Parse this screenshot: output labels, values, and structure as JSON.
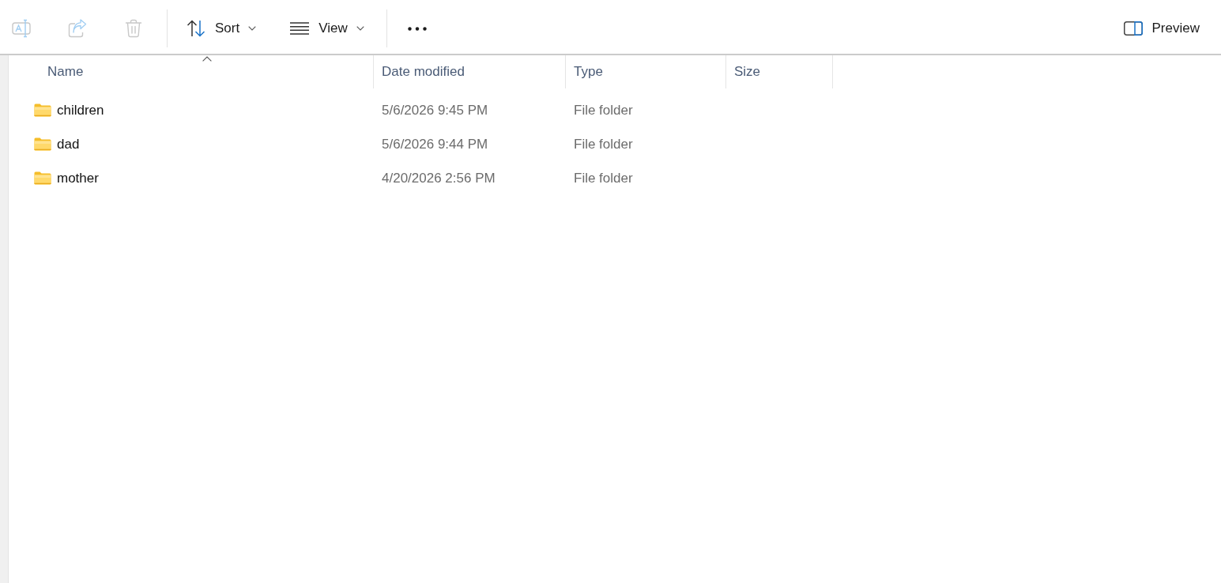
{
  "toolbar": {
    "groups": [
      {
        "items": [
          {
            "kind": "rename",
            "disabled": true
          },
          {
            "kind": "share",
            "disabled": true
          },
          {
            "kind": "delete",
            "disabled": true
          }
        ]
      },
      {
        "items": [
          {
            "kind": "sort",
            "label": "Sort",
            "disabled": false
          },
          {
            "kind": "view",
            "label": "View",
            "disabled": false
          }
        ]
      },
      {
        "items": [
          {
            "kind": "more",
            "disabled": false
          }
        ]
      }
    ],
    "preview": {
      "label": "Preview"
    }
  },
  "columns": [
    {
      "label": "Name",
      "sorted": true
    },
    {
      "label": "Date modified",
      "sorted": false
    },
    {
      "label": "Type",
      "sorted": false
    },
    {
      "label": "Size",
      "sorted": false
    }
  ],
  "rows": [
    {
      "name": "children",
      "date_modified": "5/6/2026 9:45 PM",
      "type": "File folder",
      "selected": false
    },
    {
      "name": "dad",
      "date_modified": "5/6/2026 9:44 PM",
      "type": "File folder",
      "selected": false
    },
    {
      "name": "mother",
      "date_modified": "4/20/2026 2:56 PM",
      "type": "File folder",
      "selected": false
    }
  ]
}
